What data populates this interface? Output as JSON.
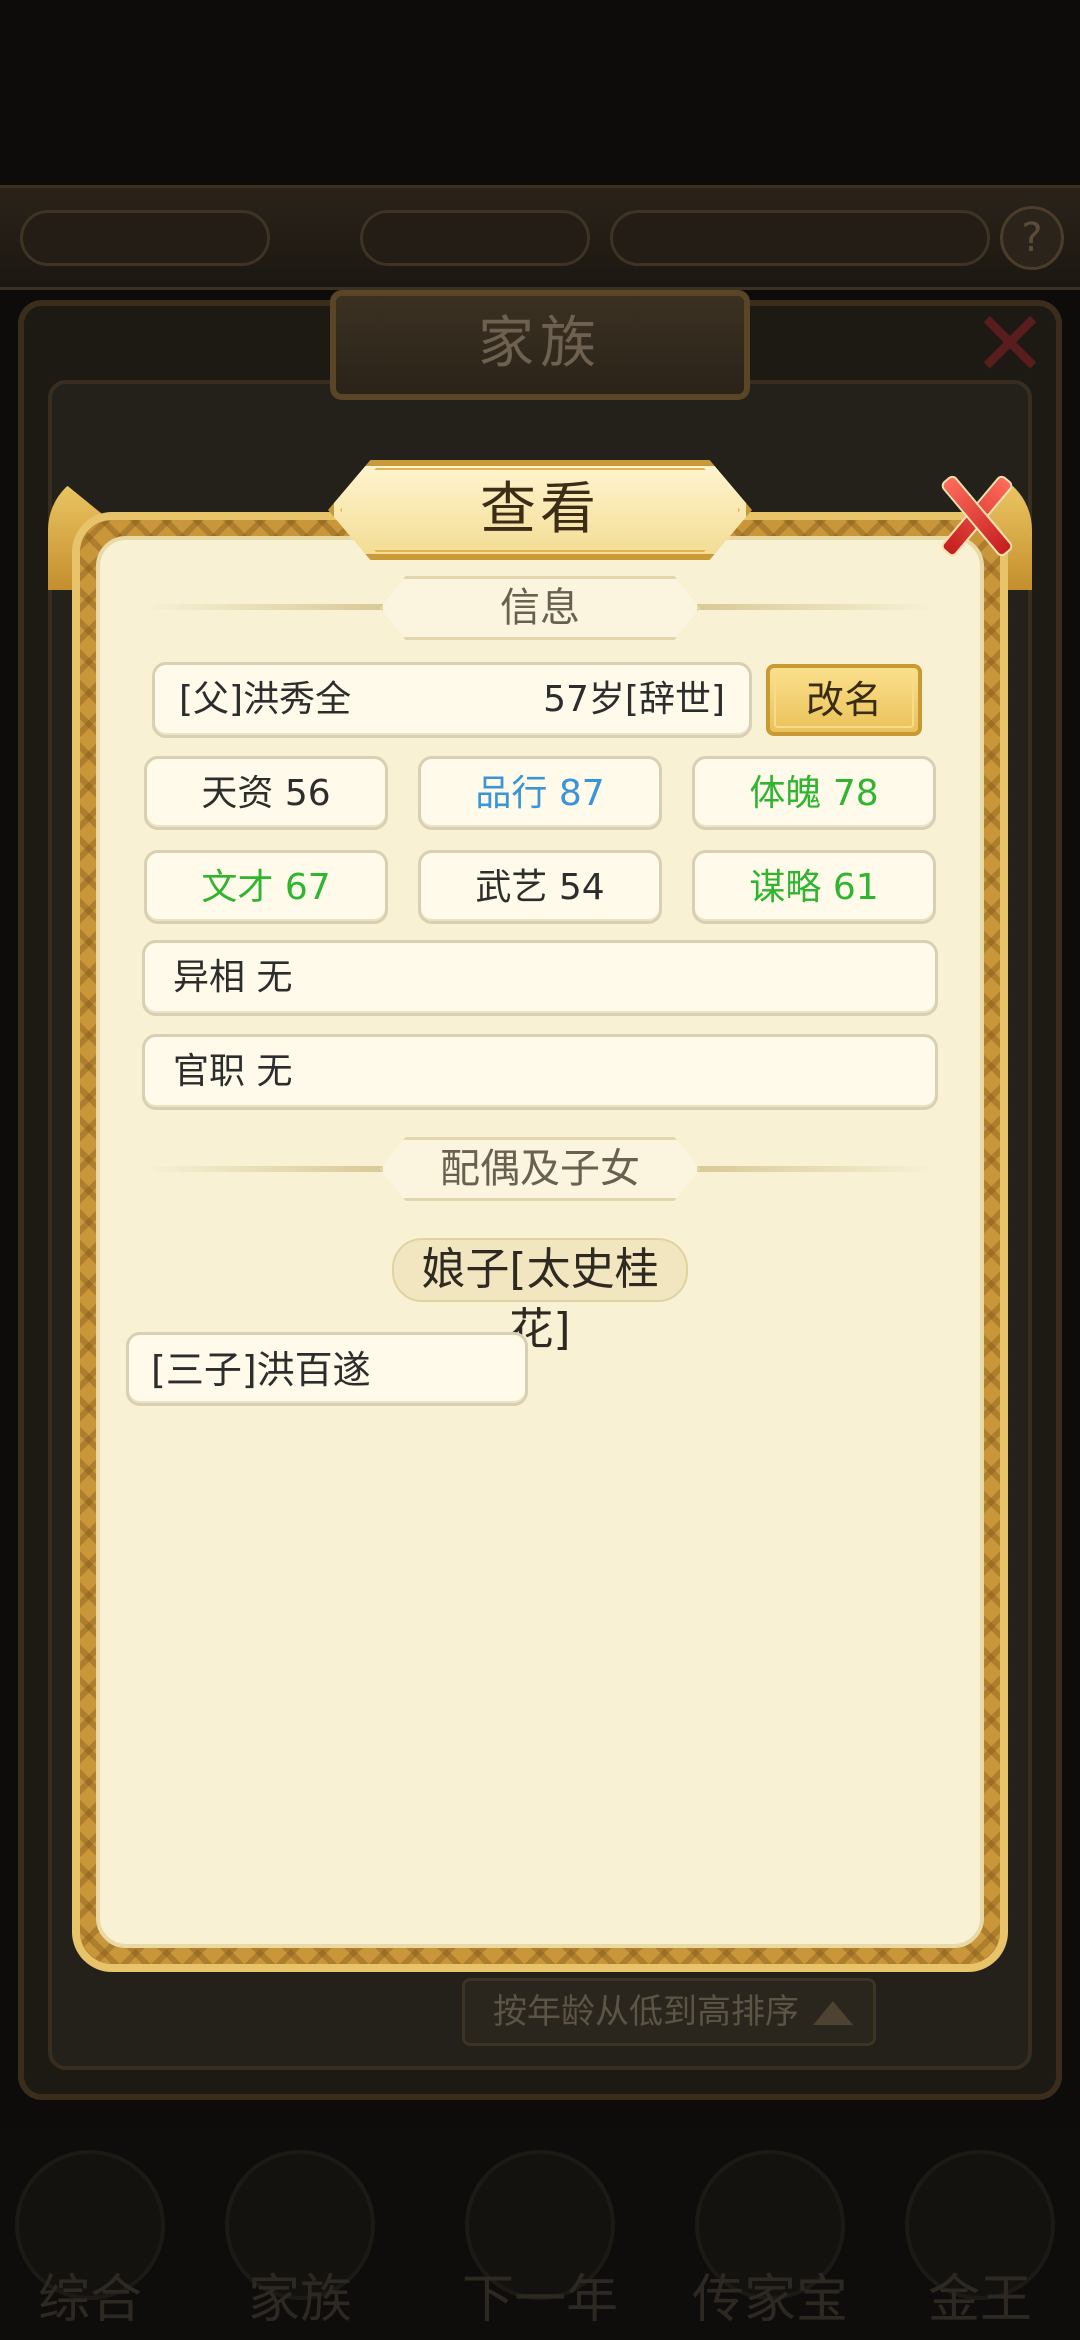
{
  "background": {
    "family_title": "家族",
    "sort_label": "按年龄从低到高排序",
    "nav": [
      "综合",
      "家族",
      "下一年",
      "传家宝",
      "金王"
    ]
  },
  "dialog": {
    "title": "查看",
    "section_info": "信息",
    "member_name": "[父]洪秀全",
    "member_age": "57岁[辞世]",
    "rename_label": "改名",
    "stats": [
      {
        "label": "天资",
        "value": "56",
        "color": "#2d2d2d"
      },
      {
        "label": "品行",
        "value": "87",
        "color": "#3a94d8"
      },
      {
        "label": "体魄",
        "value": "78",
        "color": "#2fb52f"
      },
      {
        "label": "文才",
        "value": "67",
        "color": "#2fb52f"
      },
      {
        "label": "武艺",
        "value": "54",
        "color": "#2d2d2d"
      },
      {
        "label": "谋略",
        "value": "61",
        "color": "#2fb52f"
      }
    ],
    "traits": [
      {
        "label": "异相",
        "value": "无"
      },
      {
        "label": "官职",
        "value": "无"
      }
    ],
    "section_family": "配偶及子女",
    "spouse": "娘子[太史桂花]",
    "children": [
      "[三子]洪百遂"
    ]
  }
}
